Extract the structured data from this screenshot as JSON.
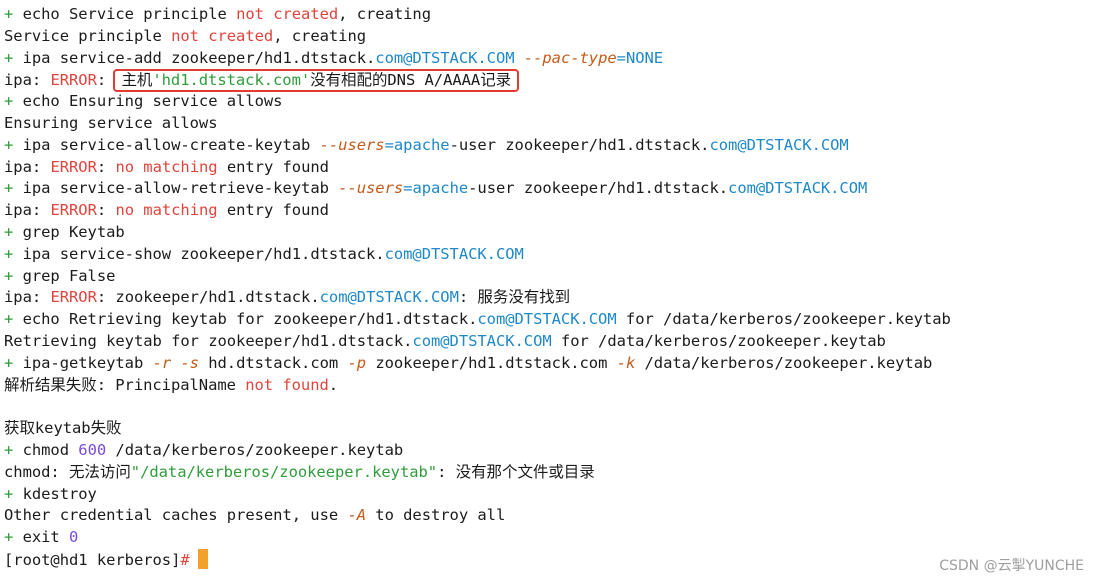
{
  "colors": {
    "prompt_plus": "#2f9d3a",
    "error": "#e0443c",
    "highlight_border": "#e23c30",
    "cursor": "#f2a12b",
    "option": "#c25b1b",
    "domain": "#1e88c9"
  },
  "lines": [
    [
      {
        "t": "+ ",
        "c": "green"
      },
      {
        "t": "echo Service principle "
      },
      {
        "t": "not created",
        "c": "red"
      },
      {
        "t": ", creating"
      }
    ],
    [
      {
        "t": "Service principle "
      },
      {
        "t": "not created",
        "c": "red"
      },
      {
        "t": ", creating"
      }
    ],
    [
      {
        "t": "+ ",
        "c": "green"
      },
      {
        "t": "ipa service-add zookeeper/hd1.dtstack."
      },
      {
        "t": "com@DTSTACK.COM",
        "c": "blue"
      },
      {
        "t": " "
      },
      {
        "t": "--pac-type",
        "c": "orange"
      },
      {
        "t": "=NONE",
        "c": "blue"
      }
    ],
    [
      {
        "t": "ipa"
      },
      {
        "t": ": "
      },
      {
        "t": "ERROR",
        "c": "red"
      },
      {
        "t": ": "
      },
      {
        "box": [
          {
            "t": "主机"
          },
          {
            "t": "'hd1.dtstack.com'",
            "c": "green"
          },
          {
            "t": "没有相配的DNS A/AAAA记录"
          }
        ]
      }
    ],
    [
      {
        "t": "+ ",
        "c": "green"
      },
      {
        "t": "echo Ensuring service allows"
      }
    ],
    [
      {
        "t": "Ensuring service allows"
      }
    ],
    [
      {
        "t": "+ ",
        "c": "green"
      },
      {
        "t": "ipa service-allow-create-keytab "
      },
      {
        "t": "--users",
        "c": "orange"
      },
      {
        "t": "=apache",
        "c": "blue"
      },
      {
        "t": "-user zookeeper/hd1.dtstack."
      },
      {
        "t": "com@DTSTACK.COM",
        "c": "blue"
      }
    ],
    [
      {
        "t": "ipa"
      },
      {
        "t": ": "
      },
      {
        "t": "ERROR",
        "c": "red"
      },
      {
        "t": ": "
      },
      {
        "t": "no matching",
        "c": "red"
      },
      {
        "t": " entry found"
      }
    ],
    [
      {
        "t": "+ ",
        "c": "green"
      },
      {
        "t": "ipa service-allow-retrieve-keytab "
      },
      {
        "t": "--users",
        "c": "orange"
      },
      {
        "t": "=apache",
        "c": "blue"
      },
      {
        "t": "-user zookeeper/hd1.dtstack."
      },
      {
        "t": "com@DTSTACK.COM",
        "c": "blue"
      }
    ],
    [
      {
        "t": "ipa"
      },
      {
        "t": ": "
      },
      {
        "t": "ERROR",
        "c": "red"
      },
      {
        "t": ": "
      },
      {
        "t": "no matching",
        "c": "red"
      },
      {
        "t": " entry found"
      }
    ],
    [
      {
        "t": "+ ",
        "c": "green"
      },
      {
        "t": "grep Keytab"
      }
    ],
    [
      {
        "t": "+ ",
        "c": "green"
      },
      {
        "t": "ipa service-show zookeeper/hd1.dtstack."
      },
      {
        "t": "com@DTSTACK.COM",
        "c": "blue"
      }
    ],
    [
      {
        "t": "+ ",
        "c": "green"
      },
      {
        "t": "grep False"
      }
    ],
    [
      {
        "t": "ipa"
      },
      {
        "t": ": "
      },
      {
        "t": "ERROR",
        "c": "red"
      },
      {
        "t": ": zookeeper/hd1.dtstack."
      },
      {
        "t": "com@DTSTACK.COM",
        "c": "blue"
      },
      {
        "t": ": 服务没有找到"
      }
    ],
    [
      {
        "t": "+ ",
        "c": "green"
      },
      {
        "t": "echo Retrieving keytab for zookeeper/hd1.dtstack."
      },
      {
        "t": "com@DTSTACK.COM",
        "c": "blue"
      },
      {
        "t": " for /data/kerberos/zookeeper.keytab"
      }
    ],
    [
      {
        "t": "Retrieving keytab for zookeeper/hd1.dtstack."
      },
      {
        "t": "com@DTSTACK.COM",
        "c": "blue"
      },
      {
        "t": " for /data/kerberos/zookeeper.keytab"
      }
    ],
    [
      {
        "t": "+ ",
        "c": "green"
      },
      {
        "t": "ipa-getkeytab "
      },
      {
        "t": "-r -s",
        "c": "orange"
      },
      {
        "t": " hd.dtstack.com "
      },
      {
        "t": "-p",
        "c": "orange"
      },
      {
        "t": " zookeeper/hd1.dtstack.com "
      },
      {
        "t": "-k",
        "c": "orange"
      },
      {
        "t": " /data/kerberos/zookeeper.keytab"
      }
    ],
    [
      {
        "t": "解析结果失败: PrincipalName "
      },
      {
        "t": "not found",
        "c": "red"
      },
      {
        "t": "."
      }
    ],
    [],
    [
      {
        "t": "获取keytab失败"
      }
    ],
    [
      {
        "t": "+ ",
        "c": "green"
      },
      {
        "t": "chmod "
      },
      {
        "t": "600",
        "c": "purple"
      },
      {
        "t": " /data/kerberos/zookeeper.keytab"
      }
    ],
    [
      {
        "t": "chmod: 无法访问"
      },
      {
        "t": "\"/data/kerberos/zookeeper.keytab\"",
        "c": "green"
      },
      {
        "t": ": 没有那个文件或目录"
      }
    ],
    [
      {
        "t": "+ ",
        "c": "green"
      },
      {
        "t": "kdestroy"
      }
    ],
    [
      {
        "t": "Other credential caches present, use "
      },
      {
        "t": "-A",
        "c": "orange"
      },
      {
        "t": " to destroy all"
      }
    ],
    [
      {
        "t": "+ ",
        "c": "green"
      },
      {
        "t": "exit "
      },
      {
        "t": "0",
        "c": "purple"
      }
    ],
    [
      {
        "t": "[root@hd1 kerberos]"
      },
      {
        "t": "#",
        "c": "red"
      },
      {
        "cursor": true
      }
    ]
  ],
  "watermark": "CSDN @云掣YUNCHE"
}
